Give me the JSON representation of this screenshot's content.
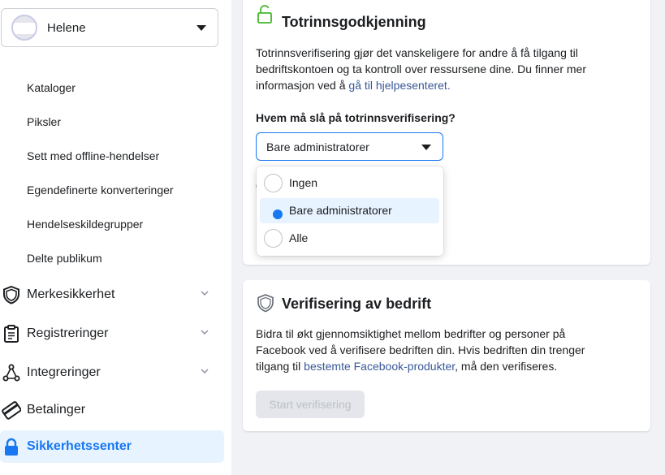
{
  "sidebar": {
    "account": {
      "name": "Helene"
    },
    "sub_items": [
      "Kataloger",
      "Piksler",
      "Sett med offline-hendelser",
      "Egendefinerte konverteringer",
      "Hendelseskildegrupper",
      "Delte publikum"
    ],
    "nav_items": [
      {
        "label": "Merkesikkerhet",
        "icon": "shield-icon",
        "expandable": true
      },
      {
        "label": "Registreringer",
        "icon": "clipboard-icon",
        "expandable": true
      },
      {
        "label": "Integreringer",
        "icon": "integrations-icon",
        "expandable": true
      },
      {
        "label": "Betalinger",
        "icon": "credit-card-icon",
        "expandable": false
      },
      {
        "label": "Sikkerhetssenter",
        "icon": "lock-icon",
        "expandable": false,
        "active": true
      }
    ]
  },
  "two_factor": {
    "title": "Totrinnsgodkjenning",
    "desc_1": "Totrinnsverifisering gjør det vanskeligere for andre å få tilgang til bedriftskontoen og ta kontroll over ressursene dine. Du finner mer informasjon ved å ",
    "desc_link": "gå til hjelpesenteret.",
    "question": "Hvem må slå på totrinnsverifisering?",
    "selected_value": "Bare administratorer",
    "partial_text": "dkjenning før de kan få tilgang til",
    "options": [
      "Ingen",
      "Bare administratorer",
      "Alle"
    ],
    "selected_index": 1
  },
  "verification": {
    "title": "Verifisering av bedrift",
    "desc_1": "Bidra til økt gjennomsiktighet mellom bedrifter og personer på Facebook ved å verifisere bedriften din. Hvis bedriften din trenger tilgang til ",
    "desc_link": "bestemte Facebook-produkter",
    "desc_2": ", må den verifiseres.",
    "button_label": "Start verifisering"
  },
  "colors": {
    "accent": "#1877f2",
    "link": "#385898",
    "active_bg": "#e7f3ff",
    "page_bg": "#f0f2f5"
  }
}
